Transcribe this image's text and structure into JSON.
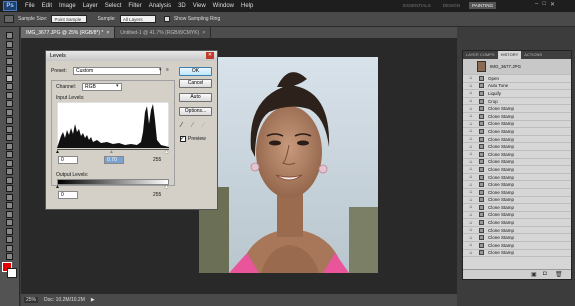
{
  "app": {
    "logo": "Ps"
  },
  "menu": [
    "File",
    "Edit",
    "Image",
    "Layer",
    "Select",
    "Filter",
    "Analysis",
    "3D",
    "View",
    "Window",
    "Help"
  ],
  "workspaces": [
    {
      "label": "ESSENTIALS",
      "active": false
    },
    {
      "label": "DESIGN",
      "active": false
    },
    {
      "label": "PAINTING",
      "active": true
    }
  ],
  "options_bar": {
    "sample_size_label": "Sample Size:",
    "sample_size_value": "Point Sample",
    "sample_label": "Sample:",
    "sample_value": "All Layers",
    "show_ring_label": "Show Sampling Ring"
  },
  "tabs": [
    {
      "label": "IMG_3677.JPG @ 25% (RGB/8*) *",
      "active": true
    },
    {
      "label": "Untitled-1 @ 41.7% (RGB/8/CMYK)",
      "active": false
    }
  ],
  "status": {
    "zoom": "25%",
    "doc": "Doc: 10.2M/10.2M"
  },
  "levels": {
    "title": "Levels",
    "preset_label": "Preset:",
    "preset_value": "Custom",
    "channel_label": "Channel:",
    "channel_value": "RGB",
    "input_levels_label": "Input Levels:",
    "input_black": "0",
    "input_gamma": "0.70",
    "input_white": "255",
    "output_levels_label": "Output Levels:",
    "output_black": "0",
    "output_white": "255",
    "ok": "OK",
    "cancel": "Cancel",
    "auto": "Auto",
    "options": "Options...",
    "preview_label": "Preview"
  },
  "history": {
    "tabs": [
      "LAYER COMPS",
      "HISTORY",
      "ACTIONS"
    ],
    "snapshot_label": "IMG_3677.JPG",
    "items": [
      "Open",
      "Auto Tone",
      "Liquify",
      "Crop",
      "Clone Stamp",
      "Clone Stamp",
      "Clone Stamp",
      "Clone Stamp",
      "Clone Stamp",
      "Clone Stamp",
      "Clone Stamp",
      "Clone Stamp",
      "Clone Stamp",
      "Clone Stamp",
      "Clone Stamp",
      "Clone Stamp",
      "Clone Stamp",
      "Clone Stamp",
      "Clone Stamp",
      "Clone Stamp",
      "Clone Stamp",
      "Clone Stamp",
      "Clone Stamp",
      "Clone Stamp"
    ]
  },
  "colors": {
    "foreground": "#e00000",
    "background": "#ffffff",
    "accent": "#3c7fb1"
  }
}
